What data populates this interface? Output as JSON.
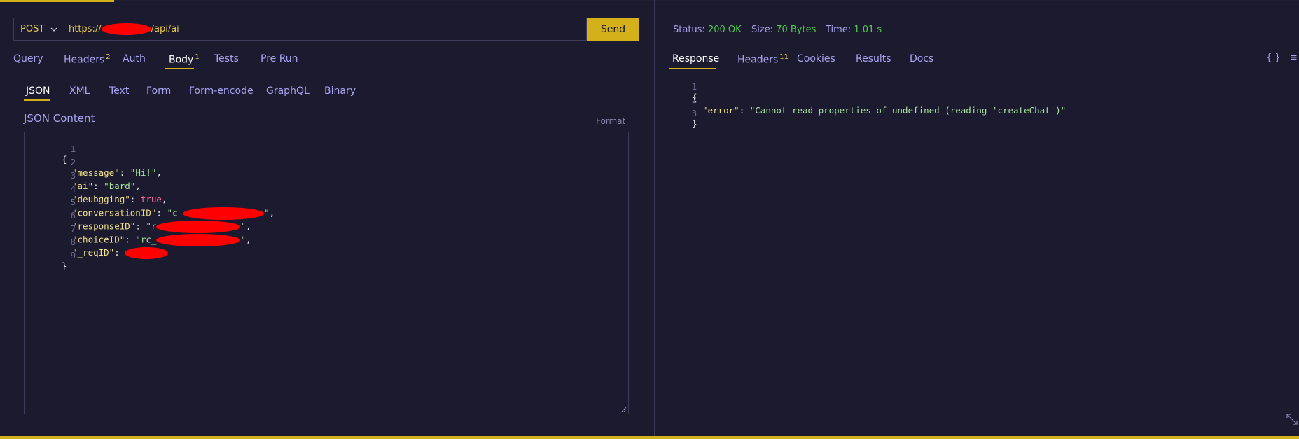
{
  "request": {
    "method": "POST",
    "url_prefix": "https://",
    "url_suffix": "/api/ai",
    "send_label": "Send"
  },
  "request_tabs": [
    {
      "label": "Query",
      "badge": ""
    },
    {
      "label": "Headers",
      "badge": "2"
    },
    {
      "label": "Auth",
      "badge": ""
    },
    {
      "label": "Body",
      "badge": "1"
    },
    {
      "label": "Tests",
      "badge": ""
    },
    {
      "label": "Pre Run",
      "badge": ""
    }
  ],
  "body_tabs": [
    "JSON",
    "XML",
    "Text",
    "Form",
    "Form-encode",
    "GraphQL",
    "Binary"
  ],
  "editor": {
    "label": "JSON Content",
    "format_label": "Format",
    "lines": [
      {
        "n": "1",
        "t": "{"
      },
      {
        "n": "2",
        "key": "\"message\"",
        "val": "\"Hi!\""
      },
      {
        "n": "3",
        "key": "\"ai\"",
        "val": "\"bard\""
      },
      {
        "n": "4",
        "key": "\"deubgging\"",
        "bool": "true"
      },
      {
        "n": "5",
        "key": "\"conversationID\"",
        "val": "\"c_"
      },
      {
        "n": "6",
        "key": "\"responseID\"",
        "val": "\"r"
      },
      {
        "n": "7",
        "key": "\"choiceID\"",
        "val": "\"rc_"
      },
      {
        "n": "8",
        "key": "\"_reqID\"",
        "val": ""
      },
      {
        "n": "9",
        "t": "}"
      }
    ]
  },
  "status": {
    "status_label": "Status:",
    "status_value": "200 OK",
    "size_label": "Size:",
    "size_value": "70 Bytes",
    "time_label": "Time:",
    "time_value": "1.01 s"
  },
  "response_tabs": [
    {
      "label": "Response",
      "badge": ""
    },
    {
      "label": "Headers",
      "badge": "11"
    },
    {
      "label": "Cookies",
      "badge": ""
    },
    {
      "label": "Results",
      "badge": ""
    },
    {
      "label": "Docs",
      "badge": ""
    }
  ],
  "response_icons": {
    "braces": "{ }",
    "menu": "≡"
  },
  "response": {
    "lines": [
      {
        "n": "1",
        "t": "{"
      },
      {
        "n": "2",
        "key": "\"error\"",
        "val": "\"Cannot read properties of undefined (reading 'createChat')\""
      },
      {
        "n": "3",
        "t": "}"
      }
    ]
  },
  "colors": {
    "accent": "#d4b01a",
    "background": "#1b1a2e",
    "success": "#4ec94e",
    "redaction": "#ff0000"
  }
}
